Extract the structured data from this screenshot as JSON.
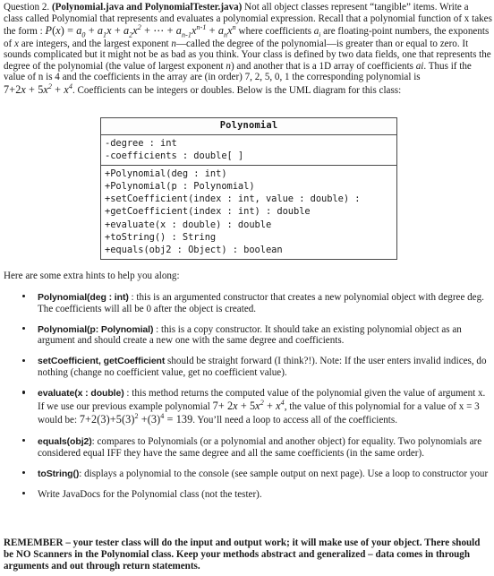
{
  "document": {
    "question_label": "Question 2.",
    "files_bold": "(Polynomial.java and PolynomialTester.java)",
    "intro_lines": [
      "Question 2. (Polynomial.java and PolynomialTester.java) Not all object classes represent “tangible” items.  Write a",
      "class called Polynomial that represents and evaluates a polynomial expression.  Recall that a polynomial function of x takes",
      "the form :  P(x) = a0 + a1x + a2x² + ⋯ + an-1xⁿ⁻¹ + anxⁿ  where coefficients ai are floating-point numbers, the exponents",
      "of x are integers, and the largest exponent n—called the degree of the polynomial—is greater than or equal to zero.  It",
      "sounds complicated but it might not be as bad as you think.  Your class is defined by two data fields, one that represents the",
      "degree of the polynomial (the value of largest exponent n) and another that is a 1D array of coefficients ai.  Thus if the",
      "value of n is 4 and the coefficients in the array are (in order) 7, 2, 5, 0, 1 the corresponding polynomial is",
      "7+2x+5x²+x⁴.  Coefficients can be integers or doubles.  Below is the UML diagram for this class:"
    ],
    "line1_a": "Question 2. ",
    "line1_b": "(Polynomial.java and PolynomialTester.java)",
    "line1_c": " Not all object classes represent “tangible” items.  Write a",
    "line2": "class called Polynomial that represents and evaluates a polynomial expression.  Recall that a polynomial function of x takes",
    "line3_pre": "the form : ",
    "line3_post": " where coefficients ",
    "line3_ai": "a",
    "line3_post2": " are floating-point numbers, the exponents",
    "line4_a": "of ",
    "line4_x": "x",
    "line4_b": " are integers, and the largest exponent ",
    "line4_n": "n",
    "line4_c": "—called the degree of the polynomial—is greater than or equal to zero.  It",
    "line5": "sounds complicated but it might not be as bad as you think.  Your class is defined by two data fields, one that represents the",
    "line6_a": "degree of the polynomial (the value of largest exponent ",
    "line6_n": "n",
    "line6_b": ") and another that is a 1D array of coefficients ",
    "line6_ai": "ai",
    "line6_c": ".  Thus if the",
    "line7": "value of n is 4 and the coefficients in the array are (in order) 7, 2, 5, 0, 1 the corresponding polynomial is",
    "line8_post": ".  Coefficients can be integers or doubles.  Below is the UML diagram for this class:"
  },
  "uml": {
    "class_name": "Polynomial",
    "attributes": [
      "-degree : int",
      "-coefficients : double[ ]"
    ],
    "methods": [
      "+Polynomial(deg : int)",
      "+Polynomial(p : Polynomial)",
      "+setCoefficient(index : int, value : double) :",
      "+getCoefficient(index : int) : double",
      "+evaluate(x : double) : double",
      "+toString() : String",
      "+equals(obj2 : Object) : boolean"
    ]
  },
  "hints": {
    "intro": "Here are some extra hints to help you along:",
    "items": [
      {
        "signature": "Polynomial(deg : int)",
        "line1_rest": " : this is an argumented constructor that creates a new polynomial object with degree deg.",
        "line2": "The coefficients will all be 0 after the object is created."
      },
      {
        "signature": "Polynomial(p: Polynomial)",
        "line1_rest": " : this is a copy constructor.  It should take an existing polynomial object as an",
        "line2": "argument and should create a new one with the same degree and coefficients."
      },
      {
        "signature": "setCoefficient, getCoefficient",
        "line1_rest": " should be straight forward (I think?!).  Note:  If the user enters invalid indices, do",
        "line2": "nothing (change no coefficient value, get no coefficient value)."
      },
      {
        "signature": "evaluate(x : double)",
        "line1_rest": " : this method returns the computed value of the polynomial given the value of argument x.",
        "line2_a": "If we use our previous example polynomial ",
        "line2_math": "7+2x+5x²+x⁴",
        "line2_b": ", the value of this polynomial for a value of x = 3",
        "line3_a": "would be:  ",
        "line3_math": "7+2(3)+5(3)²+(3)⁴ = 139",
        "line3_b": ".  You’ll need a loop to access all of the coefficients."
      },
      {
        "signature": "equals(obj2)",
        "line1_rest": ": compares to Polynomials (or a polynomial and another object) for equality.  Two polynomials are",
        "line2": "considered equal IFF they have the same degree and all the same coefficients (in the same order)."
      },
      {
        "signature": "toString()",
        "line1_rest": ": displays a polynomial to the console (see sample output on next page).  Use a loop to constructor your"
      },
      {
        "plain": "Write JavaDocs for the Polynomial class (not the tester)."
      }
    ]
  },
  "remember": {
    "line1": "REMEMBER – your tester class will do the input and output work; it will make use of your object.  There should",
    "line2": "be NO Scanners in the Polynomial class.  Keep your methods abstract and generalized – data comes in through",
    "line3": "arguments and out through return statements."
  }
}
